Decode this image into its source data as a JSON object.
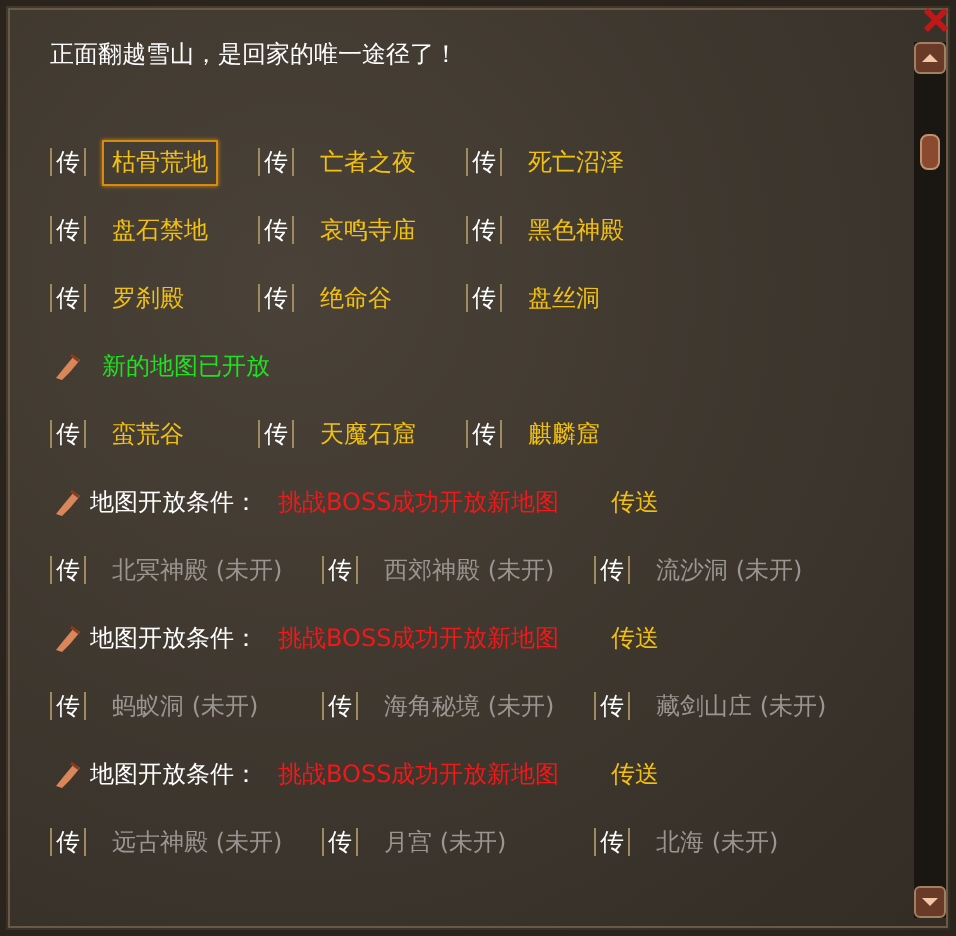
{
  "intro": "正面翻越雪山，是回家的唯一途径了！",
  "sections": [
    {
      "kind": "maps",
      "rows": [
        [
          {
            "icon": "传",
            "name": "枯骨荒地",
            "selected": true,
            "locked": false
          },
          {
            "icon": "传",
            "name": "亡者之夜",
            "selected": false,
            "locked": false
          },
          {
            "icon": "传",
            "name": "死亡沼泽",
            "selected": false,
            "locked": false
          }
        ],
        [
          {
            "icon": "传",
            "name": "盘石禁地",
            "selected": false,
            "locked": false
          },
          {
            "icon": "传",
            "name": "哀鸣寺庙",
            "selected": false,
            "locked": false
          },
          {
            "icon": "传",
            "name": "黑色神殿",
            "selected": false,
            "locked": false
          }
        ],
        [
          {
            "icon": "传",
            "name": "罗刹殿",
            "selected": false,
            "locked": false
          },
          {
            "icon": "传",
            "name": "绝命谷",
            "selected": false,
            "locked": false
          },
          {
            "icon": "传",
            "name": "盘丝洞",
            "selected": false,
            "locked": false
          }
        ]
      ]
    },
    {
      "kind": "banner",
      "text": "新的地图已开放"
    },
    {
      "kind": "maps",
      "rows": [
        [
          {
            "icon": "传",
            "name": "蛮荒谷",
            "selected": false,
            "locked": false
          },
          {
            "icon": "传",
            "name": "天魔石窟",
            "selected": false,
            "locked": false
          },
          {
            "icon": "传",
            "name": "麒麟窟",
            "selected": false,
            "locked": false
          }
        ]
      ]
    },
    {
      "kind": "condition",
      "label": "地图开放条件：",
      "condition": "挑战BOSS成功开放新地图",
      "link": "传送"
    },
    {
      "kind": "maps",
      "rows": [
        [
          {
            "icon": "传",
            "name": "北冥神殿 (未开)",
            "selected": false,
            "locked": true
          },
          {
            "icon": "传",
            "name": "西郊神殿 (未开)",
            "selected": false,
            "locked": true
          },
          {
            "icon": "传",
            "name": "流沙洞 (未开)",
            "selected": false,
            "locked": true
          }
        ]
      ]
    },
    {
      "kind": "condition",
      "label": "地图开放条件：",
      "condition": "挑战BOSS成功开放新地图",
      "link": "传送"
    },
    {
      "kind": "maps",
      "rows": [
        [
          {
            "icon": "传",
            "name": "蚂蚁洞 (未开)",
            "selected": false,
            "locked": true
          },
          {
            "icon": "传",
            "name": "海角秘境 (未开)",
            "selected": false,
            "locked": true
          },
          {
            "icon": "传",
            "name": "藏剑山庄 (未开)",
            "selected": false,
            "locked": true
          }
        ]
      ]
    },
    {
      "kind": "condition",
      "label": "地图开放条件：",
      "condition": "挑战BOSS成功开放新地图",
      "link": "传送"
    },
    {
      "kind": "maps",
      "rows": [
        [
          {
            "icon": "传",
            "name": "远古神殿 (未开)",
            "selected": false,
            "locked": true
          },
          {
            "icon": "传",
            "name": "月宫 (未开)",
            "selected": false,
            "locked": true
          },
          {
            "icon": "传",
            "name": "北海 (未开)",
            "selected": false,
            "locked": true
          }
        ]
      ]
    }
  ]
}
